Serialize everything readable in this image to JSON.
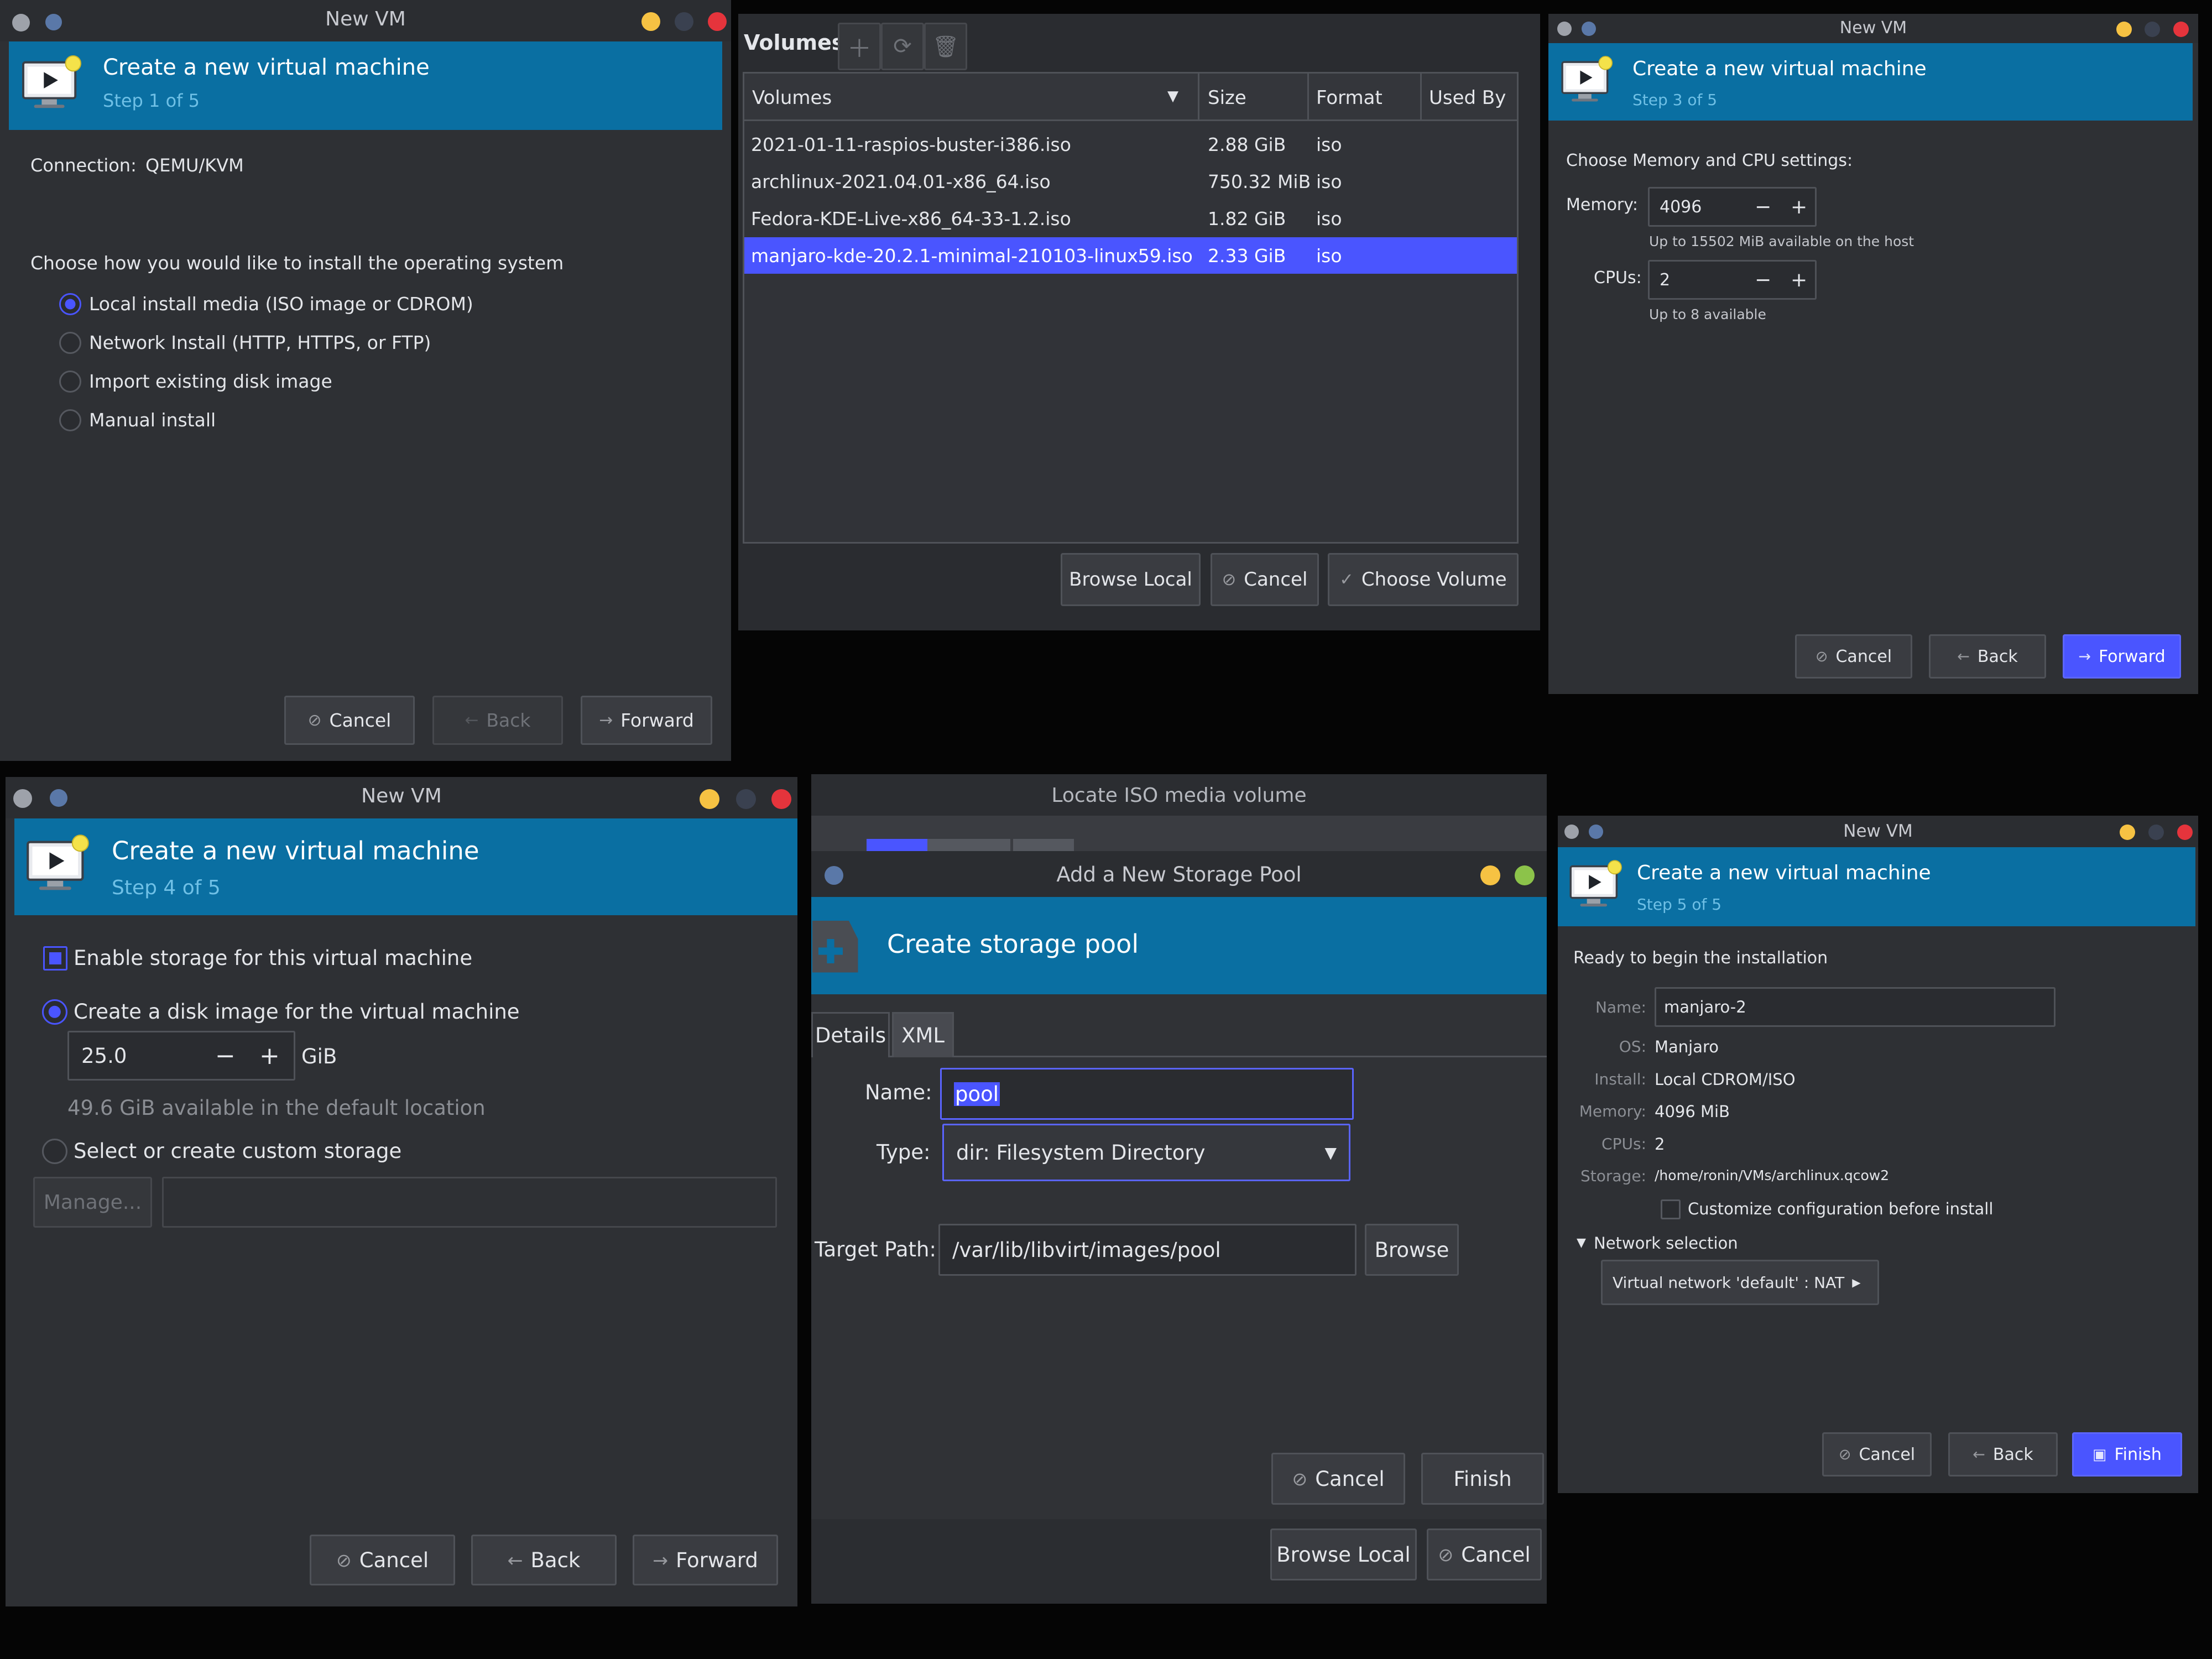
{
  "window_step1": {
    "title": "New VM",
    "banner_title": "Create a new virtual machine",
    "banner_step": "Step 1 of 5",
    "connection_label": "Connection:",
    "connection_value": "QEMU/KVM",
    "prompt": "Choose how you would like to install the operating system",
    "options": [
      {
        "label": "Local install media (ISO image or CDROM)",
        "selected": true
      },
      {
        "label": "Network Install (HTTP, HTTPS, or FTP)",
        "selected": false
      },
      {
        "label": "Import existing disk image",
        "selected": false
      },
      {
        "label": "Manual install",
        "selected": false
      }
    ],
    "cancel": "Cancel",
    "back": "Back",
    "forward": "Forward"
  },
  "volumes_window": {
    "title": "Volumes",
    "columns": [
      "Volumes",
      "Size",
      "Format",
      "Used By"
    ],
    "rows": [
      {
        "name": "2021-01-11-raspios-buster-i386.iso",
        "size": "2.88 GiB",
        "format": "iso",
        "selected": false
      },
      {
        "name": "archlinux-2021.04.01-x86_64.iso",
        "size": "750.32 MiB",
        "format": "iso",
        "selected": false
      },
      {
        "name": "Fedora-KDE-Live-x86_64-33-1.2.iso",
        "size": "1.82 GiB",
        "format": "iso",
        "selected": false
      },
      {
        "name": "manjaro-kde-20.2.1-minimal-210103-linux59.iso",
        "size": "2.33 GiB",
        "format": "iso",
        "selected": true
      }
    ],
    "browse_local": "Browse Local",
    "cancel": "Cancel",
    "choose_volume": "Choose Volume"
  },
  "window_step3": {
    "title": "New VM",
    "banner_title": "Create a new virtual machine",
    "banner_step": "Step 3 of 5",
    "prompt": "Choose Memory and CPU settings:",
    "memory_label": "Memory:",
    "memory_value": "4096",
    "memory_hint": "Up to 15502 MiB available on the host",
    "cpus_label": "CPUs:",
    "cpus_value": "2",
    "cpus_hint": "Up to 8 available",
    "cancel": "Cancel",
    "back": "Back",
    "forward": "Forward"
  },
  "window_step4": {
    "title": "New VM",
    "banner_title": "Create a new virtual machine",
    "banner_step": "Step 4 of 5",
    "enable_storage": "Enable storage for this virtual machine",
    "enable_storage_checked": true,
    "create_disk": "Create a disk image for the virtual machine",
    "disk_size": "25.0",
    "disk_unit": "GiB",
    "available": "49.6 GiB available in the default location",
    "custom_storage": "Select or create custom storage",
    "manage": "Manage...",
    "cancel": "Cancel",
    "back": "Back",
    "forward": "Forward"
  },
  "locate_iso": {
    "title": "Locate ISO media volume",
    "browse_local": "Browse Local",
    "cancel": "Cancel"
  },
  "storage_pool": {
    "title": "Add a New Storage Pool",
    "banner_title": "Create storage pool",
    "tabs": [
      "Details",
      "XML"
    ],
    "name_label": "Name:",
    "name_value": "pool",
    "type_label": "Type:",
    "type_value": "dir: Filesystem Directory",
    "target_label": "Target Path:",
    "target_value": "/var/lib/libvirt/images/pool",
    "browse": "Browse",
    "cancel": "Cancel",
    "finish": "Finish"
  },
  "window_step5": {
    "title": "New VM",
    "banner_title": "Create a new virtual machine",
    "banner_step": "Step 5 of 5",
    "ready": "Ready to begin the installation",
    "name_label": "Name:",
    "name_value": "manjaro-2",
    "os_label": "OS:",
    "os_value": "Manjaro",
    "install_label": "Install:",
    "install_value": "Local CDROM/ISO",
    "memory_label": "Memory:",
    "memory_value": "4096 MiB",
    "cpus_label": "CPUs:",
    "cpus_value": "2",
    "storage_label": "Storage:",
    "storage_value": "/home/ronin/VMs/archlinux.qcow2",
    "customize": "Customize configuration before install",
    "network_section": "Network selection",
    "network_value": "Virtual network 'default' : NAT",
    "cancel": "Cancel",
    "back": "Back",
    "finish": "Finish"
  },
  "colors": {
    "banner": "#0a6fa2",
    "accent": "#4a55ff",
    "window_bg": "#2e3034",
    "close": "#e5343c",
    "minimize": "#f6c243"
  }
}
